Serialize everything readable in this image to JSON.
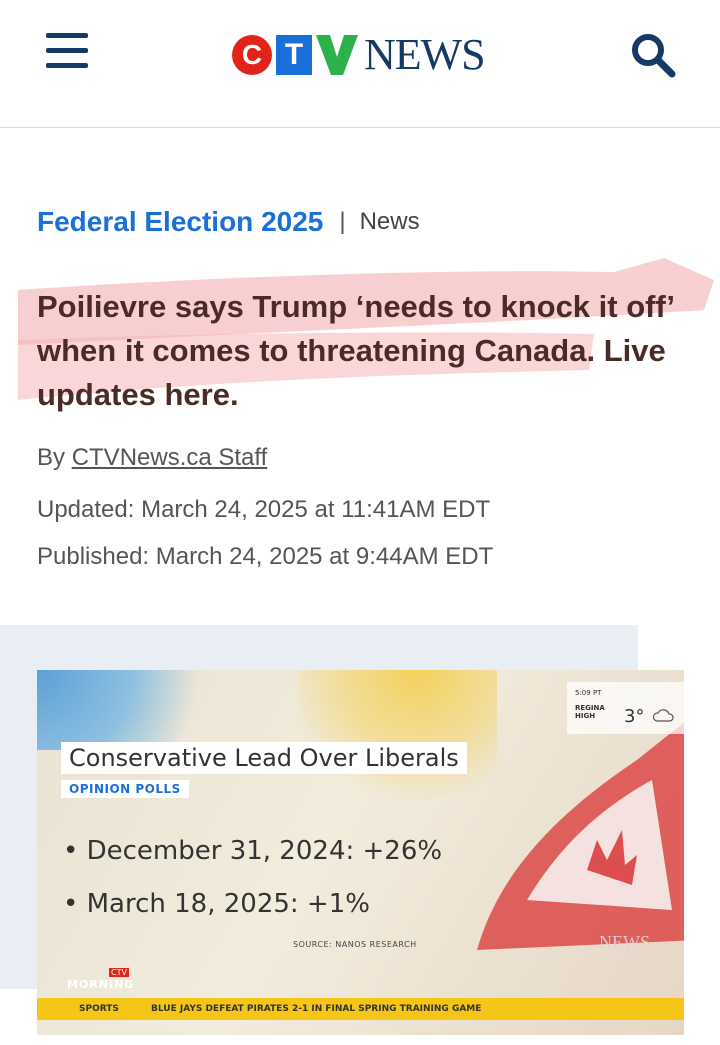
{
  "header": {
    "logo_letters": [
      "C",
      "T",
      "V"
    ],
    "logo_word": "NEWS"
  },
  "article": {
    "section": "Federal Election 2025",
    "separator": "|",
    "subsection": "News",
    "headline": "Poilievre says Trump ‘needs to knock it off’ when it comes to threatening Canada. Live updates here.",
    "byline_prefix": "By",
    "author": "CTVNews.ca Staff",
    "updated": "Updated: March 24, 2025 at 11:41AM EDT",
    "published": "Published: March 24, 2025 at 9:44AM EDT"
  },
  "video": {
    "title": "Conservative Lead Over Liberals",
    "tag": "OPINION POLLS",
    "bullets": [
      "December 31, 2024: +26%",
      "March 18, 2025: +1%"
    ],
    "source": "SOURCE: NANOS RESEARCH",
    "weather_time": "5:09 PT",
    "weather_city": "REGINA HIGH",
    "weather_temp": "3°",
    "watermark": "NEWS",
    "show_brand_small": "CTV",
    "show_name": "MORNING",
    "ticker_label": "SPORTS",
    "ticker_text": "BLUE JAYS DEFEAT PIRATES 2-1 IN FINAL SPRING TRAINING GAME"
  }
}
